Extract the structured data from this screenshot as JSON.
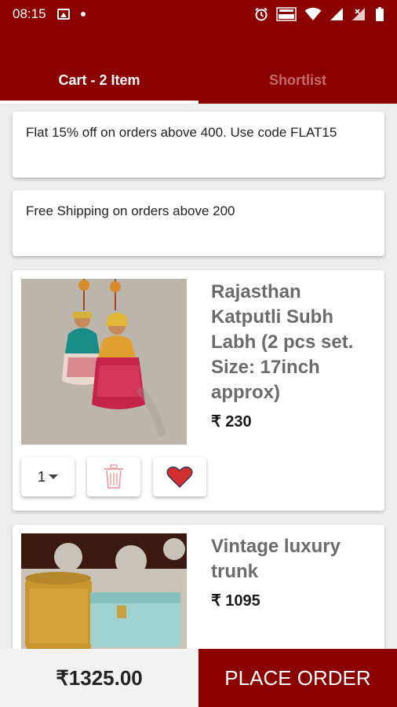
{
  "status_bar": {
    "time": "08:15"
  },
  "tabs": {
    "cart_label": "Cart - 2 Item",
    "shortlist_label": "Shortlist"
  },
  "offers": [
    {
      "text": "Flat 15% off on orders above 400. Use code FLAT15"
    },
    {
      "text": "Free Shipping on orders above 200"
    }
  ],
  "products": [
    {
      "title": "Rajasthan Katputli Subh Labh (2 pcs set. Size: 17inch approx)",
      "price": "₹ 230",
      "quantity": "1"
    },
    {
      "title": "Vintage luxury trunk",
      "price": "₹ 1095"
    }
  ],
  "bottom": {
    "total": "₹1325.00",
    "place_order_label": "PLACE ORDER"
  },
  "colors": {
    "brand": "#8b0000",
    "heart": "#d32f2f"
  },
  "icons": [
    "image-icon",
    "alarm-icon",
    "volte-icon",
    "wifi-icon",
    "signal-icon",
    "battery-icon",
    "delete-icon",
    "heart-icon"
  ]
}
